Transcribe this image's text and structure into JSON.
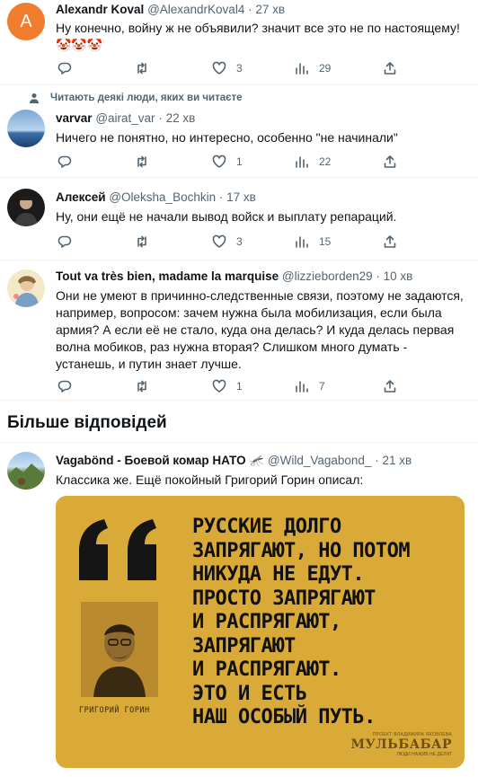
{
  "tweets": [
    {
      "avatar_letter": "A",
      "avatar_color": "#f07c2e",
      "name": "Alexandr Koval",
      "handle": "@AlexandrKoval4",
      "time": "27 хв",
      "text": "Ну конечно, войну ж не объявили? значит все это не по настоящему! 🤡🤡🤡",
      "likes": "3",
      "views": "29"
    },
    {
      "social_context": "Читають деякі люди, яких ви читаєте",
      "name": "varvar",
      "handle": "@airat_var",
      "time": "22 хв",
      "text": "Ничего не понятно, но интересно, особенно \"не начинали\"",
      "likes": "1",
      "views": "22"
    },
    {
      "name": "Алексей",
      "handle": "@Oleksha_Bochkin",
      "time": "17 хв",
      "text": "Ну, они ещё не начали вывод войск и выплату репараций.",
      "likes": "3",
      "views": "15"
    },
    {
      "name": "Tout va très bien, madame la marquise",
      "handle": "@lizzieborden29",
      "time": "10 хв",
      "text": "Они не умеют в причинно-следственные связи, поэтому не задаются, например, вопросом: зачем нужна была мобилизация, если была армия? А если её не стало, куда она делась? И куда делась первая волна мобиков, раз нужна вторая? Слишком много думать - устанешь, и путин знает лучше.",
      "likes": "1",
      "views": "7"
    }
  ],
  "more_replies_label": "Більше відповідей",
  "last_tweet": {
    "name": "Vagabönd - Боевой комар НАТО",
    "name_emoji": "🦟",
    "handle": "@Wild_Vagabond_",
    "time": "21 хв",
    "text": "Классика же. Ещё покойный Григорий Горин описал:",
    "quote_image": {
      "text": "РУССКИЕ ДОЛГО\nЗАПРЯГАЮТ, НО ПОТОМ\nНИКУДА НЕ ЕДУТ.\nПРОСТО ЗАПРЯГАЮТ\nИ РАСПРЯГАЮТ,\nЗАПРЯГАЮТ\nИ РАСПРЯГАЮТ.\nЭТО И ЕСТЬ\nНАШ ОСОБЫЙ ПУТЬ.",
      "author": "ГРИГОРИЙ ГОРИН",
      "brand_top": "ПРОЕКТ ВЛАДИМИРА ЯКОВЛЕВА",
      "brand": "МУЛЬБАБАР",
      "brand_sub": "ЛЮДИ НАЖИВ НЕ ДЕЛЯТ",
      "background": "#d9aa37"
    }
  }
}
